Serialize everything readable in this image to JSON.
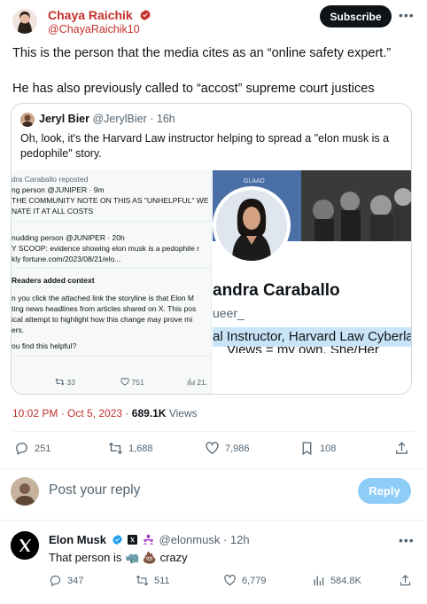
{
  "main_tweet": {
    "author_name": "Chaya Raichik",
    "author_handle": "@ChayaRaichik10",
    "subscribe_label": "Subscribe",
    "text_line1": "This is the person that the media cites as an “online safety expert.”",
    "text_line2": "He has also previously called to “accost” supreme court justices",
    "timestamp": "10:02 PM · Oct 5, 2023",
    "views_count": "689.1K",
    "views_label": "Views",
    "stats": {
      "replies": "251",
      "retweets": "1,688",
      "likes": "7,986",
      "bookmarks": "108"
    }
  },
  "quote": {
    "author_name": "Jeryl Bier",
    "author_handle": "@JerylBier",
    "time": "· 16h",
    "text": "Oh, look, it's the Harvard Law instructor helping to spread a \"elon musk is a pedophile\" story.",
    "left_image": {
      "reposted": "dra Caraballo reposted",
      "line1_name": "ng person",
      "line1_meta": "@JUNIPER · 9m",
      "line2": "THE COMMUNITY NOTE ON THIS AS \"UNHELPFUL\" WE",
      "line3": "NATE IT AT ALL COSTS",
      "line4_name": "nudding person",
      "line4_meta": "@JUNIPER · 20h",
      "line5": "Y SCOOP: evidence showing elon musk is a pedophile r",
      "line6": "kly fortune.com/2023/08/21/elo...",
      "line7": "Readers added context",
      "line8": "n you click the attached link the storyline is that Elon M",
      "line9": "ting news headlines from articles shared on X. This pos",
      "line10": "ical attempt to highlight how this change may prove mi",
      "line11": "ers.",
      "line12": "ou find this helpful?",
      "stat1": "33",
      "stat2": "751",
      "stat3": "21."
    },
    "right_image": {
      "banner_text": "GLAAD",
      "name": "andra Caraballo",
      "pronoun": "ueer_",
      "bio_highlight": "al Instructor, Harvard Law Cyberla",
      "bio_next": "Views = my own. She/Her"
    }
  },
  "reply_box": {
    "placeholder": "Post your reply",
    "reply_label": "Reply"
  },
  "reply": {
    "author_name": "Elon Musk",
    "author_handle": "@elonmusk",
    "time": "· 12h",
    "text": "That person is 🦏 💩 crazy",
    "stats": {
      "replies": "347",
      "retweets": "511",
      "likes": "6,779",
      "views": "584.8K"
    }
  },
  "colors": {
    "brand_red": "#c4302b",
    "verified_blue": "#1d9bf0",
    "reply_button": "#8ecdf8",
    "highlight": "#c9e4f7"
  }
}
